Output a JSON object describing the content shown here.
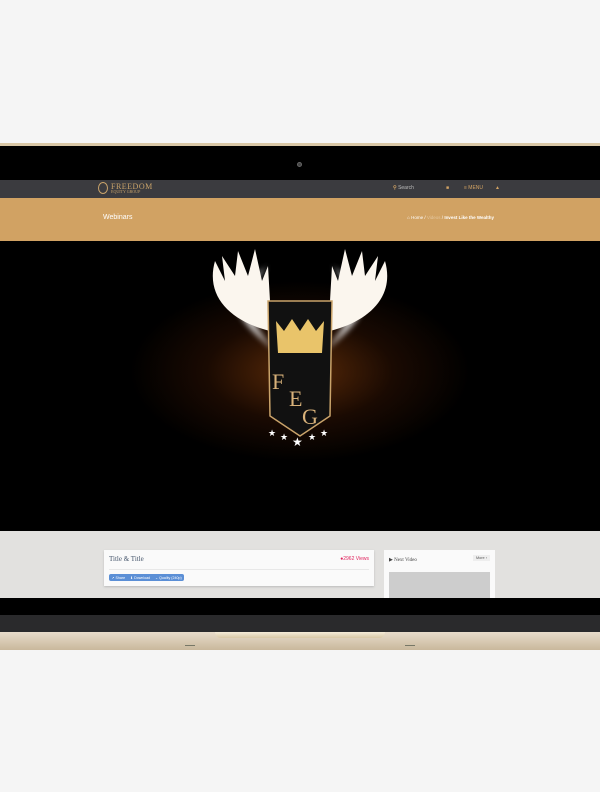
{
  "brand": {
    "name_line1": "FREEDOM",
    "name_line2": "EQUITY GROUP"
  },
  "nav": {
    "search_placeholder": "Search",
    "menu_label": "≡ MENU",
    "home_icon": "home-icon",
    "user_icon": "user-icon"
  },
  "header": {
    "title": "Webinars",
    "breadcrumb": [
      "Home",
      "Videos",
      "Invest Like the Wealthy"
    ]
  },
  "video": {
    "logo_letters": "FEG"
  },
  "card": {
    "title": "Title & Title",
    "views": "2962 Views",
    "buttons": [
      "↗ Share",
      "⬇ Download",
      "⌄ Quality (240p)"
    ]
  },
  "sidebar": {
    "next_label": "▶ Next Video",
    "more_label": "More ›"
  },
  "colors": {
    "accent": "#d1a263",
    "nav": "#3b3b3f",
    "views": "#e0245e",
    "button": "#5b8fd6"
  }
}
